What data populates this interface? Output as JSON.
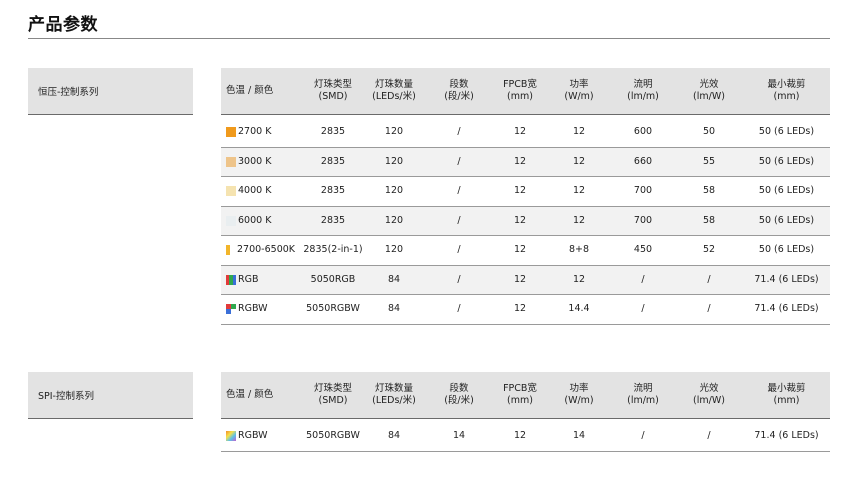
{
  "page": {
    "title": "产品参数"
  },
  "colors": {
    "2700K": "#f09a1c",
    "3000K": "#eec48a",
    "4000K": "#f5e3b0",
    "6000K": "#e9eef0",
    "tunable": "#f2b52a",
    "rgb": [
      "#e23b3b",
      "#2fa84f",
      "#3a6fd8"
    ],
    "rgbw": [
      "#e23b3b",
      "#2fa84f",
      "#3a6fd8",
      "#ffffff"
    ]
  },
  "headers": [
    [
      "色温 / 颜色"
    ],
    [
      "灯珠类型",
      "(SMD)"
    ],
    [
      "灯珠数量",
      "(LEDs/米)"
    ],
    [
      "段数",
      "(段/米)"
    ],
    [
      "FPCB宽",
      "(mm)"
    ],
    [
      "功率",
      "(W/m)"
    ],
    [
      "流明",
      "(lm/m)"
    ],
    [
      "光效",
      "(lm/W)"
    ],
    [
      "最小裁剪",
      "(mm)"
    ]
  ],
  "section1": {
    "label": "恒压-控制系列",
    "rows": [
      {
        "swatch": "2700K",
        "color_label": "2700 K",
        "smd": "2835",
        "leds": "120",
        "segments": "/",
        "fpcb": "12",
        "power": "12",
        "lumen": "600",
        "efficacy": "50",
        "min_cut": "50 (6 LEDs)"
      },
      {
        "swatch": "3000K",
        "color_label": "3000 K",
        "smd": "2835",
        "leds": "120",
        "segments": "/",
        "fpcb": "12",
        "power": "12",
        "lumen": "660",
        "efficacy": "55",
        "min_cut": "50 (6 LEDs)"
      },
      {
        "swatch": "4000K",
        "color_label": "4000 K",
        "smd": "2835",
        "leds": "120",
        "segments": "/",
        "fpcb": "12",
        "power": "12",
        "lumen": "700",
        "efficacy": "58",
        "min_cut": "50 (6 LEDs)"
      },
      {
        "swatch": "6000K",
        "color_label": "6000 K",
        "smd": "2835",
        "leds": "120",
        "segments": "/",
        "fpcb": "12",
        "power": "12",
        "lumen": "700",
        "efficacy": "58",
        "min_cut": "50 (6 LEDs)"
      },
      {
        "swatch": "tunable",
        "color_label": "2700-6500K",
        "smd": "2835(2-in-1)",
        "leds": "120",
        "segments": "/",
        "fpcb": "12",
        "power": "8+8",
        "lumen": "450",
        "efficacy": "52",
        "min_cut": "50 (6 LEDs)"
      },
      {
        "swatch": "rgb",
        "color_label": "RGB",
        "smd": "5050RGB",
        "leds": "84",
        "segments": "/",
        "fpcb": "12",
        "power": "12",
        "lumen": "/",
        "efficacy": "/",
        "min_cut": "71.4 (6 LEDs)"
      },
      {
        "swatch": "rgbw",
        "color_label": "RGBW",
        "smd": "5050RGBW",
        "leds": "84",
        "segments": "/",
        "fpcb": "12",
        "power": "14.4",
        "lumen": "/",
        "efficacy": "/",
        "min_cut": "71.4 (6 LEDs)"
      }
    ]
  },
  "section2": {
    "label": "SPI-控制系列",
    "rows": [
      {
        "swatch": "gradient",
        "color_label": "RGBW",
        "smd": "5050RGBW",
        "leds": "84",
        "segments": "14",
        "fpcb": "12",
        "power": "14",
        "lumen": "/",
        "efficacy": "/",
        "min_cut": "71.4 (6 LEDs)"
      }
    ]
  }
}
